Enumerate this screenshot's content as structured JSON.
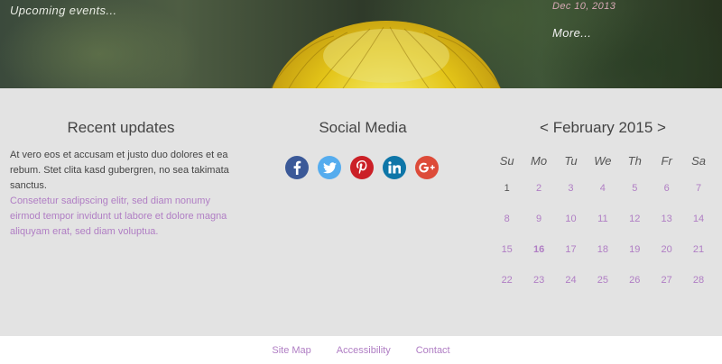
{
  "hero": {
    "left_text": "Upcoming events...",
    "event_date": "Dec 10, 2013",
    "more_link": "More..."
  },
  "updates": {
    "title": "Recent updates",
    "body_text": "At vero eos et accusam et justo duo dolores et ea rebum. Stet clita kasd gubergren, no sea takimata sanctus.",
    "link_text": "Consetetur sadipscing elitr, sed diam nonumy eirmod tempor invidunt ut labore et dolore magna aliquyam erat, sed diam voluptua."
  },
  "social": {
    "title": "Social Media",
    "icons": [
      {
        "name": "facebook-icon",
        "color": "#3b5998",
        "glyph": "f"
      },
      {
        "name": "twitter-icon",
        "color": "#55acee",
        "glyph": "t"
      },
      {
        "name": "pinterest-icon",
        "color": "#cb2027",
        "glyph": "p"
      },
      {
        "name": "linkedin-icon",
        "color": "#0e76a8",
        "glyph": "in"
      },
      {
        "name": "google-plus-icon",
        "color": "#dd4b39",
        "glyph": "g+"
      }
    ]
  },
  "calendar": {
    "prev": "<",
    "month": "February 2015",
    "next": ">",
    "weekdays": [
      "Su",
      "Mo",
      "Tu",
      "We",
      "Th",
      "Fr",
      "Sa"
    ],
    "weeks": [
      [
        "1",
        "2",
        "3",
        "4",
        "5",
        "6",
        "7"
      ],
      [
        "8",
        "9",
        "10",
        "11",
        "12",
        "13",
        "14"
      ],
      [
        "15",
        "16",
        "17",
        "18",
        "19",
        "20",
        "21"
      ],
      [
        "22",
        "23",
        "24",
        "25",
        "26",
        "27",
        "28"
      ]
    ],
    "today": "16",
    "non_link_days": [
      "1"
    ]
  },
  "footer": {
    "links": [
      "Site Map",
      "Accessibility",
      "Contact"
    ]
  },
  "colors": {
    "accent": "#b07ec4",
    "band": "#e3e3e3",
    "text": "#444444"
  }
}
